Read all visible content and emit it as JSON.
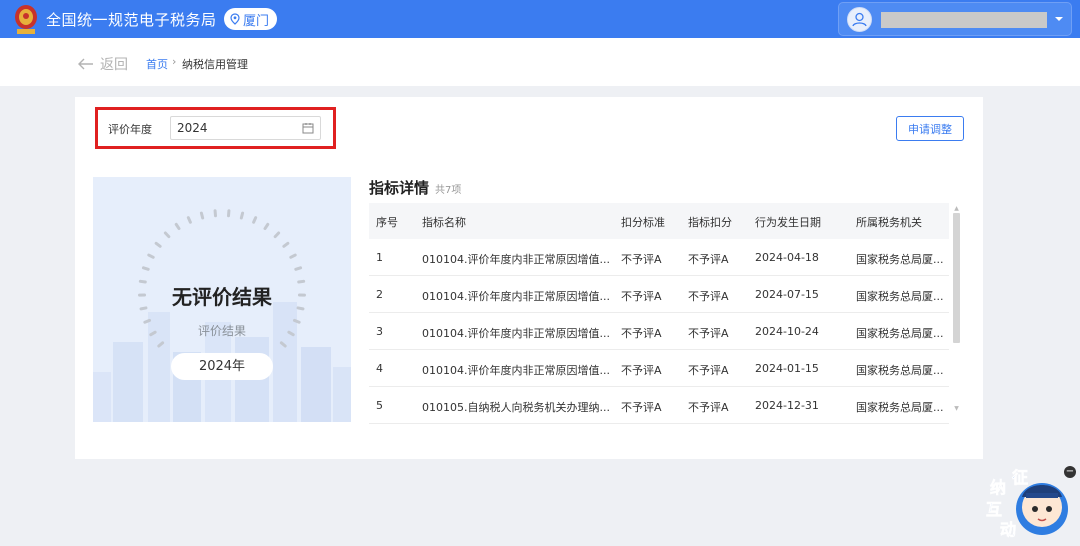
{
  "header": {
    "site_title": "全国统一规范电子税务局",
    "city": "厦门",
    "user_name": "",
    "brand_color": "#3b7cf0"
  },
  "breadcrumb": {
    "back_label": "返回",
    "home": "首页",
    "separator": "›",
    "current": "纳税信用管理"
  },
  "filter": {
    "label": "评价年度",
    "year_value": "2024",
    "apply_button": "申请调整"
  },
  "result": {
    "title": "无评价结果",
    "subtitle": "评价结果",
    "year_badge": "2024年"
  },
  "details": {
    "title": "指标详情",
    "count": "共7项",
    "columns": [
      "序号",
      "指标名称",
      "扣分标准",
      "指标扣分",
      "行为发生日期",
      "所属税务机关"
    ],
    "rows": [
      [
        "1",
        "010104.评价年度内非正常原因增值...",
        "不予评A",
        "不予评A",
        "2024-04-18",
        "国家税务总局厦..."
      ],
      [
        "2",
        "010104.评价年度内非正常原因增值...",
        "不予评A",
        "不予评A",
        "2024-07-15",
        "国家税务总局厦..."
      ],
      [
        "3",
        "010104.评价年度内非正常原因增值...",
        "不予评A",
        "不予评A",
        "2024-10-24",
        "国家税务总局厦..."
      ],
      [
        "4",
        "010104.评价年度内非正常原因增值...",
        "不予评A",
        "不予评A",
        "2024-01-15",
        "国家税务总局厦..."
      ],
      [
        "5",
        "010105.自纳税人向税务机关办理纳...",
        "不予评A",
        "不予评A",
        "2024-12-31",
        "国家税务总局厦..."
      ]
    ]
  },
  "widget": {
    "text": [
      "征",
      "纳",
      "互",
      "动"
    ]
  },
  "icons": [
    "emblem-icon",
    "location-pin-icon",
    "user-avatar-icon",
    "caret-down-icon",
    "back-arrow-icon",
    "calendar-icon"
  ]
}
